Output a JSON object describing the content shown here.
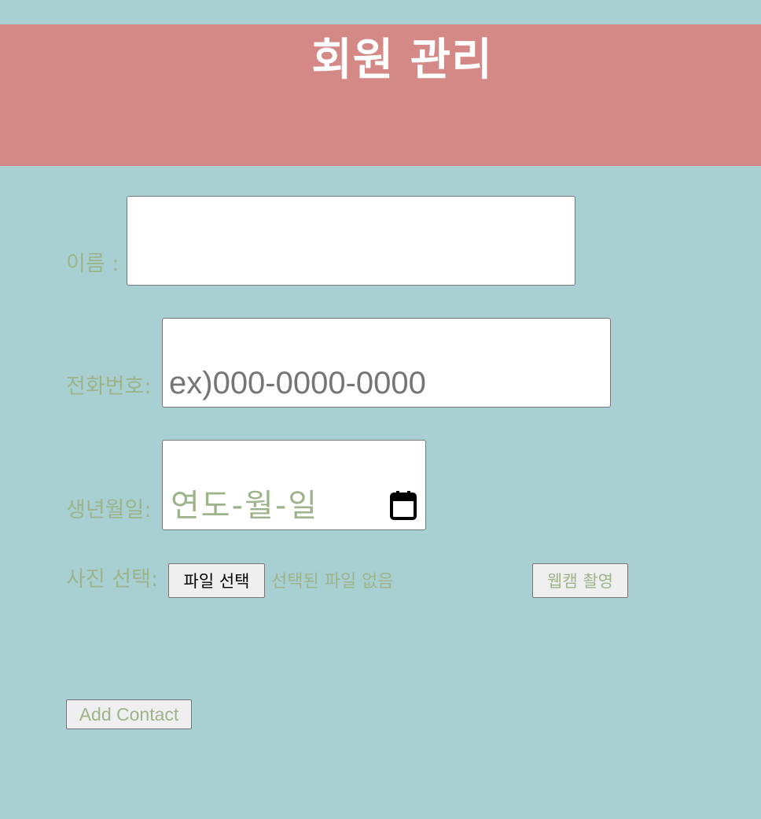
{
  "header": {
    "title": "회원 관리"
  },
  "form": {
    "name": {
      "label": "이름 :",
      "value": ""
    },
    "phone": {
      "label": "전화번호:",
      "placeholder": "ex)000-0000-0000",
      "value": ""
    },
    "birthdate": {
      "label": "생년월일:",
      "placeholder_text": "연도-월-일",
      "icon": "calendar-icon"
    },
    "photo": {
      "label": "사진 선택:",
      "file_button_label": "파일 선택",
      "file_status": "선택된 파일 없음",
      "webcam_button_label": "웹캠 촬영"
    },
    "submit_label": "Add Contact"
  },
  "colors": {
    "background": "#a8d0d3",
    "header": "#d58987",
    "label": "#9db48b"
  }
}
